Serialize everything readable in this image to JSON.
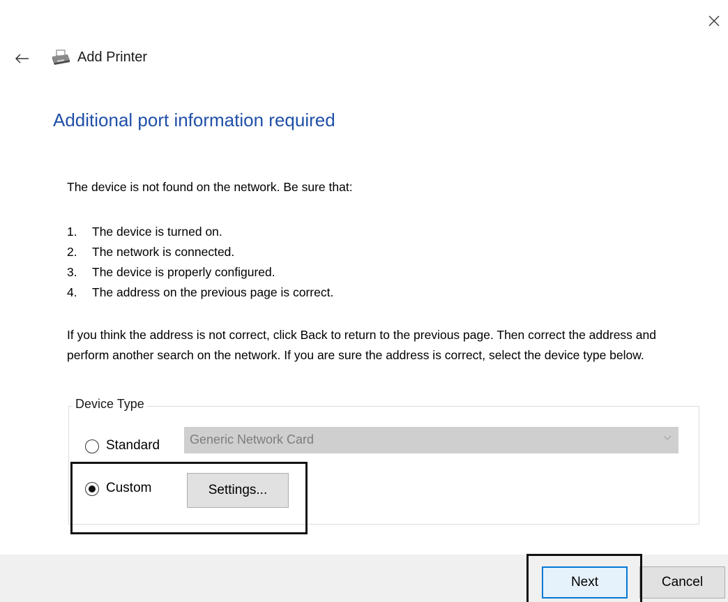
{
  "window": {
    "title": "Add Printer",
    "icons": {
      "close": "close-icon",
      "back": "back-arrow-icon",
      "app": "printer-icon"
    }
  },
  "page": {
    "heading": "Additional port information required",
    "intro": "The device is not found on the network.  Be sure that:",
    "checklist": [
      {
        "num": "1.",
        "text": "The device is turned on."
      },
      {
        "num": "2.",
        "text": "The network is connected."
      },
      {
        "num": "3.",
        "text": "The device is properly configured."
      },
      {
        "num": "4.",
        "text": "The address on the previous page is correct."
      }
    ],
    "instructions": "If you think the address is not correct, click Back to return to the previous page.  Then correct the address and perform another search on the network.  If you are sure the address is correct, select the device type below."
  },
  "device_type": {
    "legend": "Device Type",
    "options": {
      "standard": {
        "label": "Standard",
        "selected": false
      },
      "custom": {
        "label": "Custom",
        "selected": true
      }
    },
    "standard_select": {
      "value": "Generic Network Card",
      "disabled": true
    },
    "settings_button": "Settings..."
  },
  "footer": {
    "next": "Next",
    "cancel": "Cancel"
  },
  "colors": {
    "heading": "#1f4fa8",
    "footer_bg": "#f0f0f0",
    "primary_border": "#0078d7",
    "highlight": "#111111"
  }
}
